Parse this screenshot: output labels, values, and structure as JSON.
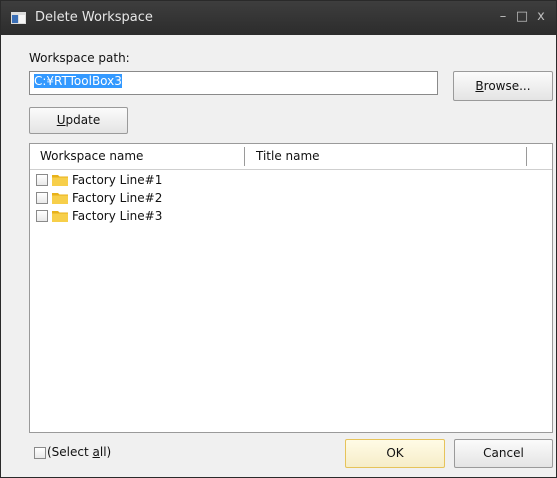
{
  "window": {
    "title": "Delete Workspace",
    "controls": {
      "minimize": "–",
      "maximize": "□",
      "close": "x"
    }
  },
  "workspace": {
    "path_label": "Workspace path:",
    "path_value": "C:¥RTToolBox3",
    "browse_label_accel": "B",
    "browse_label_rest": "rowse...",
    "update_label_accel": "U",
    "update_label_rest": "pdate"
  },
  "list": {
    "columns": [
      "Workspace name",
      "Title name"
    ],
    "items": [
      {
        "name": "Factory Line#1",
        "title": "",
        "checked": false
      },
      {
        "name": "Factory Line#2",
        "title": "",
        "checked": false
      },
      {
        "name": "Factory Line#3",
        "title": "",
        "checked": false
      }
    ]
  },
  "footer": {
    "select_all_prefix": "(Select ",
    "select_all_accel": "a",
    "select_all_suffix": "ll)",
    "ok_label": "OK",
    "cancel_label": "Cancel"
  },
  "colors": {
    "titlebar": "#333333",
    "selection": "#3399ff",
    "folder": "#f2c12e",
    "default_button_border": "#e6c35a"
  },
  "icons": [
    "window-icon",
    "minimize-icon",
    "maximize-icon",
    "close-icon",
    "folder-icon",
    "checkbox-icon"
  ]
}
